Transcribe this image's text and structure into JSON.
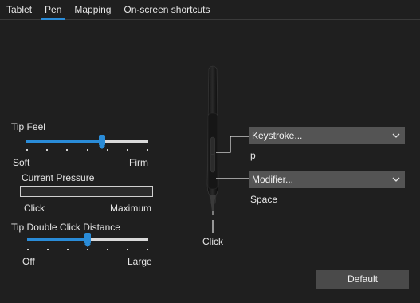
{
  "tabs": [
    {
      "label": "Tablet"
    },
    {
      "label": "Pen"
    },
    {
      "label": "Mapping"
    },
    {
      "label": "On-screen shortcuts"
    }
  ],
  "active_tab": "Pen",
  "tip_feel": {
    "label": "Tip Feel",
    "min_label": "Soft",
    "max_label": "Firm",
    "value_fraction": 0.62
  },
  "current_pressure": {
    "label": "Current Pressure",
    "min_label": "Click",
    "max_label": "Maximum",
    "value_fraction": 0
  },
  "double_click": {
    "label": "Tip Double Click Distance",
    "min_label": "Off",
    "max_label": "Large",
    "value_fraction": 0.5
  },
  "upper_button": {
    "select_value": "Keystroke...",
    "assigned_value": "p"
  },
  "lower_button": {
    "select_value": "Modifier...",
    "assigned_value": "Space"
  },
  "tip_label": "Click",
  "default_button": "Default",
  "colors": {
    "accent": "#2a8cd8",
    "background": "#1f1f1f",
    "dropdown": "#545454"
  }
}
